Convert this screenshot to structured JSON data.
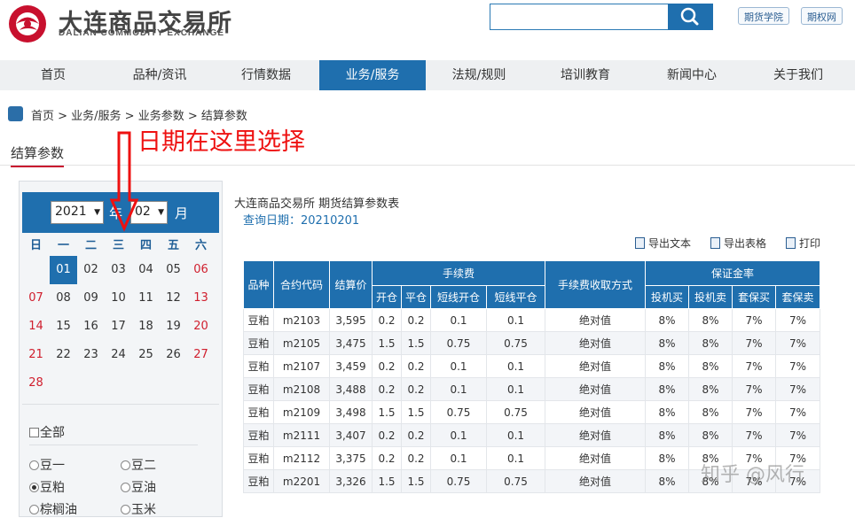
{
  "header": {
    "logo_cn": "大连商品交易所",
    "logo_en": "DALIAN COMMODITY EXCHANGE",
    "links": [
      "期货学院",
      "期权网"
    ]
  },
  "nav": {
    "items": [
      "首页",
      "品种/资讯",
      "行情数据",
      "业务/服务",
      "法规/规则",
      "培训教育",
      "新闻中心",
      "关于我们"
    ],
    "active": "业务/服务"
  },
  "breadcrumb": "首页 > 业务/服务 > 业务参数 > 结算参数",
  "section_title": "结算参数",
  "annotation": "日期在这里选择",
  "calendar": {
    "year": "2021",
    "year_unit": "年",
    "month": "02",
    "month_unit": "月",
    "weekdays": [
      "日",
      "一",
      "二",
      "三",
      "四",
      "五",
      "六"
    ],
    "weeks": [
      [
        "",
        "01",
        "02",
        "03",
        "04",
        "05",
        "06"
      ],
      [
        "07",
        "08",
        "09",
        "10",
        "11",
        "12",
        "13"
      ],
      [
        "14",
        "15",
        "16",
        "17",
        "18",
        "19",
        "20"
      ],
      [
        "21",
        "22",
        "23",
        "24",
        "25",
        "26",
        "27"
      ],
      [
        "28",
        "",
        "",
        "",
        "",
        "",
        ""
      ]
    ],
    "selected_day": "01",
    "weekend_color": "#d01f2e"
  },
  "filters": {
    "all_label": "全部",
    "varieties": [
      {
        "label": "豆一",
        "checked": false
      },
      {
        "label": "豆二",
        "checked": false
      },
      {
        "label": "豆粕",
        "checked": true
      },
      {
        "label": "豆油",
        "checked": false
      },
      {
        "label": "棕榈油",
        "checked": false
      },
      {
        "label": "玉米",
        "checked": false
      }
    ]
  },
  "content": {
    "title": "大连商品交易所 期货结算参数表",
    "query_date": "查询日期：20210201",
    "tools": [
      "导出文本",
      "导出表格",
      "打印"
    ],
    "header_row1": [
      "品种",
      "合约代码",
      "结算价",
      "手续费",
      "手续费收取方式",
      "保证金率"
    ],
    "header_row2": [
      "开仓",
      "平仓",
      "短线开仓",
      "短线平仓",
      "投机买",
      "投机卖",
      "套保买",
      "套保卖"
    ],
    "rows": [
      [
        "豆粕",
        "m2103",
        "3,595",
        "0.2",
        "0.2",
        "0.1",
        "0.1",
        "绝对值",
        "8%",
        "8%",
        "7%",
        "7%"
      ],
      [
        "豆粕",
        "m2105",
        "3,475",
        "1.5",
        "1.5",
        "0.75",
        "0.75",
        "绝对值",
        "8%",
        "8%",
        "7%",
        "7%"
      ],
      [
        "豆粕",
        "m2107",
        "3,459",
        "0.2",
        "0.2",
        "0.1",
        "0.1",
        "绝对值",
        "8%",
        "8%",
        "7%",
        "7%"
      ],
      [
        "豆粕",
        "m2108",
        "3,488",
        "0.2",
        "0.2",
        "0.1",
        "0.1",
        "绝对值",
        "8%",
        "8%",
        "7%",
        "7%"
      ],
      [
        "豆粕",
        "m2109",
        "3,498",
        "1.5",
        "1.5",
        "0.75",
        "0.75",
        "绝对值",
        "8%",
        "8%",
        "7%",
        "7%"
      ],
      [
        "豆粕",
        "m2111",
        "3,407",
        "0.2",
        "0.2",
        "0.1",
        "0.1",
        "绝对值",
        "8%",
        "8%",
        "7%",
        "7%"
      ],
      [
        "豆粕",
        "m2112",
        "3,375",
        "0.2",
        "0.2",
        "0.1",
        "0.1",
        "绝对值",
        "8%",
        "8%",
        "7%",
        "7%"
      ],
      [
        "豆粕",
        "m2201",
        "3,326",
        "1.5",
        "1.5",
        "0.75",
        "0.75",
        "绝对值",
        "8%",
        "8%",
        "7%",
        "7%"
      ]
    ]
  },
  "watermark": "知乎 @风行",
  "colors": {
    "primary": "#1f6fae",
    "accent_red": "#c8102e"
  }
}
